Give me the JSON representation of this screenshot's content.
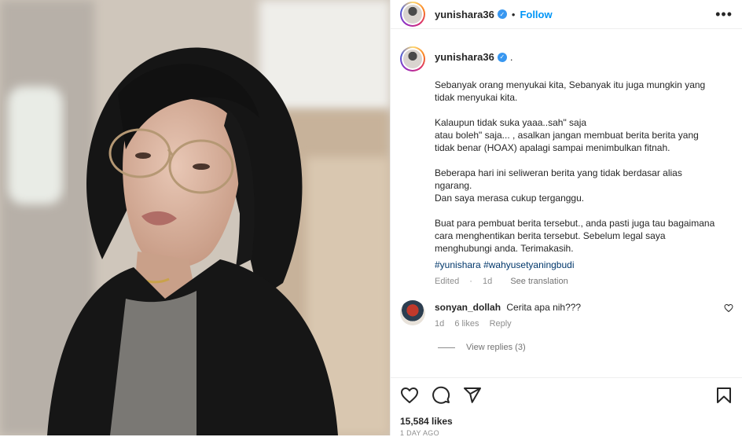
{
  "post": {
    "username": "yunishara36",
    "header_separator": "•",
    "follow_label": "Follow",
    "more_icon": "more-options-icon"
  },
  "caption": {
    "username": "yunishara36",
    "suffix": ".",
    "text": "Sebanyak orang menyukai kita, Sebanyak itu juga mungkin yang tidak menyukai kita.\n\nKalaupun tidak suka yaaa..sah\" saja\natau boleh\" saja... , asalkan jangan membuat berita berita yang tidak benar (HOAX) apalagi sampai menimbulkan fitnah.\n\nBeberapa hari ini seliweran berita yang tidak berdasar alias ngarang.\nDan saya merasa cukup terganggu.\n\nBuat para pembuat berita tersebut., anda pasti juga tau bagaimana cara menghentikan berita tersebut. Sebelum legal saya menghubungi anda. Terimakasih.",
    "hashtags": [
      "#yunishara",
      "#wahyusetyaningbudi"
    ],
    "edited_label": "Edited",
    "meta_separator": "·",
    "age": "1d",
    "see_translation": "See translation"
  },
  "comments": [
    {
      "username": "sonyan_dollah",
      "text": "Cerita apa nih???",
      "age": "1d",
      "likes": "6 likes",
      "reply_label": "Reply",
      "view_replies": "View replies (3)"
    }
  ],
  "footer": {
    "likes": "15,584 likes",
    "time": "1 DAY AGO"
  },
  "colors": {
    "link_blue": "#0095f6",
    "verified_blue": "#3897f0",
    "hashtag_blue": "#00376b",
    "muted_text": "#8e8e8e"
  },
  "icons": [
    "verified-badge-icon",
    "heart-icon",
    "comment-icon",
    "share-icon",
    "bookmark-icon",
    "small-heart-icon"
  ]
}
